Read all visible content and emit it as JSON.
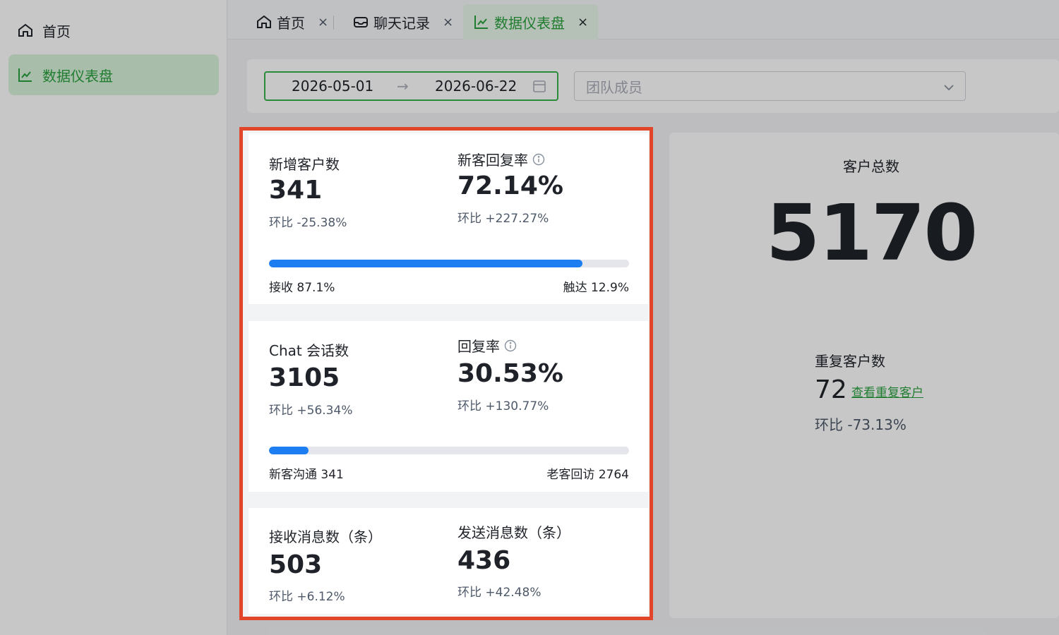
{
  "sidebar": {
    "items": [
      {
        "label": "首页",
        "icon": "home-icon",
        "active": false
      },
      {
        "label": "数据仪表盘",
        "icon": "chart-icon",
        "active": true
      }
    ]
  },
  "tabs": [
    {
      "label": "首页",
      "icon": "home-icon",
      "close": "×"
    },
    {
      "label": "聊天记录",
      "icon": "inbox-icon",
      "close": "×"
    },
    {
      "label": "数据仪表盘",
      "icon": "chart-icon",
      "close": "×",
      "active": true
    }
  ],
  "filters": {
    "start_date": "2026-05-01",
    "arrow": "→",
    "end_date": "2026-06-22",
    "member_placeholder": "团队成员"
  },
  "cards": {
    "new_customers": {
      "label": "新增客户数",
      "value": "341",
      "change": "环比 -25.38%",
      "reply_label": "新客回复率",
      "reply_value": "72.14%",
      "reply_change": "环比 +227.27%",
      "progress": 0.871,
      "left_label": "接收 87.1%",
      "right_label": "触达 12.9%"
    },
    "chat_sessions": {
      "label": "Chat 会话数",
      "value": "3105",
      "change": "环比 +56.34%",
      "reply_label": "回复率",
      "reply_value": "30.53%",
      "reply_change": "环比 +130.77%",
      "progress": 0.11,
      "left_label": "新客沟通 341",
      "right_label": "老客回访 2764"
    },
    "messages": {
      "recv_label": "接收消息数（条）",
      "recv_value": "503",
      "recv_change": "环比 +6.12%",
      "sent_label": "发送消息数（条）",
      "sent_value": "436",
      "sent_change": "环比 +42.48%"
    }
  },
  "summary": {
    "total_label": "客户总数",
    "total_value": "5170",
    "repeat_label": "重复客户数",
    "repeat_value": "72",
    "repeat_link": "查看重复客户",
    "repeat_change": "环比 -73.13%"
  },
  "colors": {
    "accent": "#2aa13e",
    "progress": "#1c7ef0",
    "highlight": "#e1462a"
  }
}
